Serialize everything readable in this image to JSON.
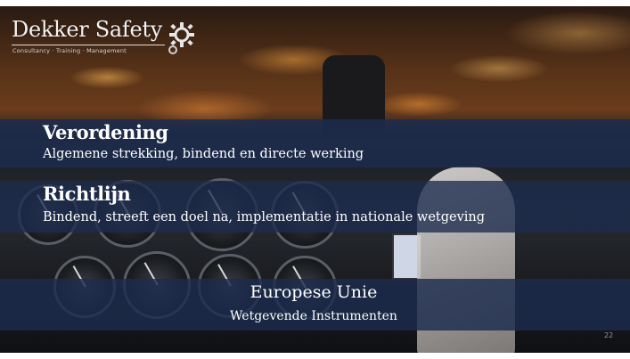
{
  "logo": {
    "name": "Dekker Safety",
    "tagline": "Consultancy · Training · Management"
  },
  "items": [
    {
      "title": "Verordening",
      "description": "Algemene strekking, bindend en directe werking"
    },
    {
      "title": "Richtlijn",
      "description": "Bindend, streeft een doel na, implementatie in nationale wetgeving"
    }
  ],
  "footer_band": {
    "title": "Europese Unie",
    "subtitle": "Wetgevende Instrumenten"
  },
  "page_number": "22",
  "icons": {
    "logo": "gear-icon"
  },
  "colors": {
    "band": "#1c2c4e",
    "text": "#ffffff"
  }
}
